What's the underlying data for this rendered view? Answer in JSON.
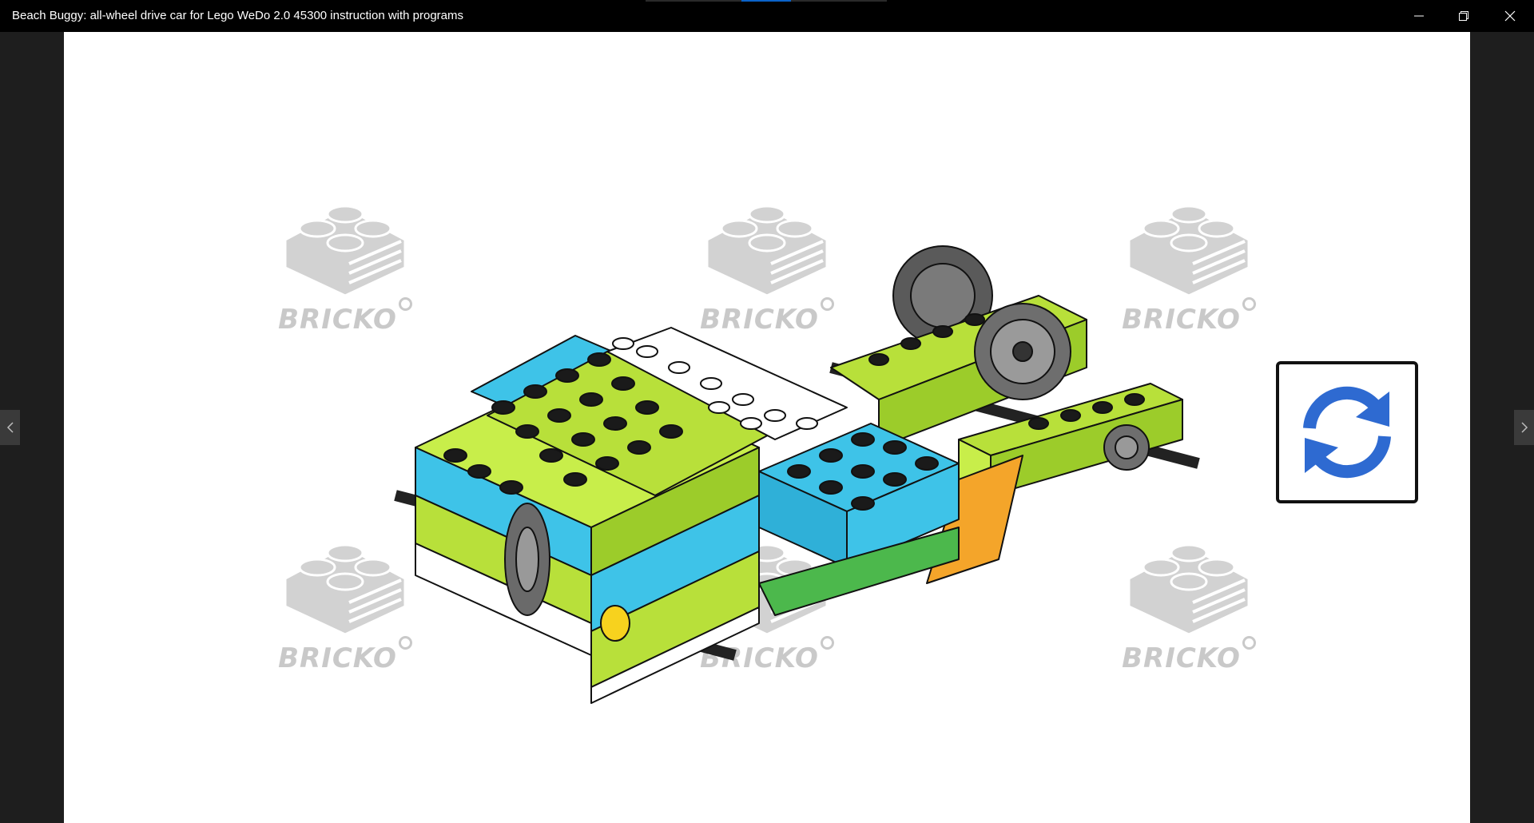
{
  "window": {
    "title": "Beach Buggy: all-wheel drive car for Lego WeDo 2.0 45300 instruction with programs",
    "minimize_icon": "minimize-icon",
    "maximize_icon": "restore-icon",
    "close_icon": "close-icon"
  },
  "viewer": {
    "watermark_text": "BRICKO",
    "watermark_icon": "brick-logo-icon",
    "rotate_icon": "rotate-arrows-icon",
    "prev_icon": "chevron-left-icon",
    "next_icon": "chevron-right-icon",
    "model_image": "lego-beach-buggy-model"
  },
  "colors": {
    "lime": "#b8e03a",
    "azure": "#3ec3e8",
    "white": "#ffffff",
    "gear_gray": "#6b6b6b",
    "rotate_blue": "#2e6ad1",
    "titlebar": "#000000",
    "side_panel": "#1e1e1e"
  }
}
